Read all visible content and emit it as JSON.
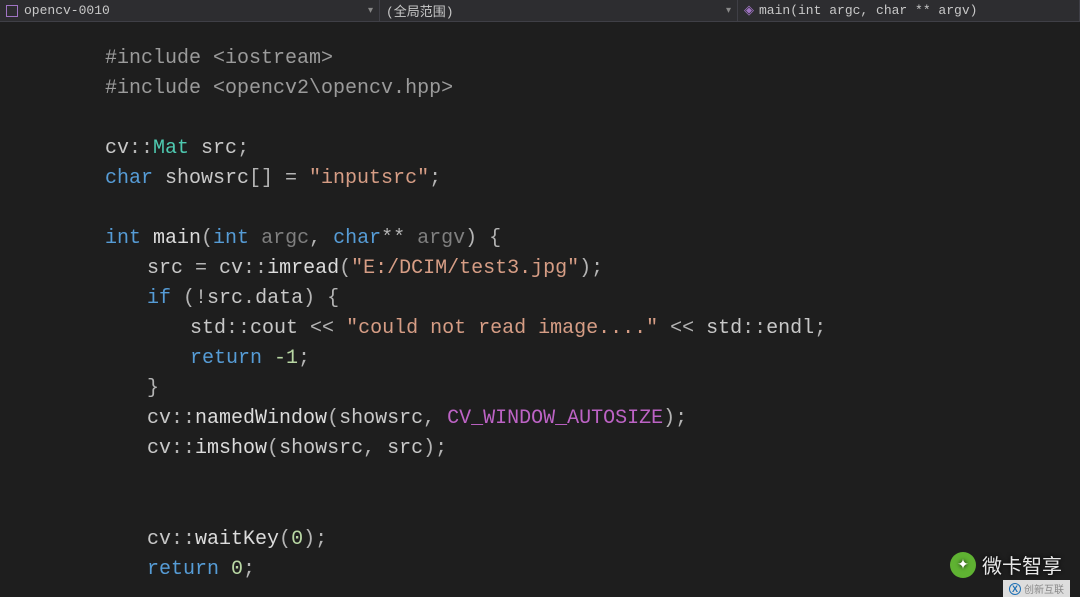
{
  "topbar": {
    "project": "opencv-0010",
    "scope": "(全局范围)",
    "func": "main(int argc, char ** argv)"
  },
  "code": {
    "l1a": "#include ",
    "l1b": "<iostream>",
    "l2a": "#include ",
    "l2b": "<opencv2\\opencv.hpp>",
    "l4a": "cv",
    "l4op": "::",
    "l4b": "Mat",
    "l4c": " src",
    "l4d": ";",
    "l5a": "char",
    "l5b": " showsrc",
    "l5c": "[] = ",
    "l5d": "\"inputsrc\"",
    "l5e": ";",
    "l7a": "int",
    "l7b": " main",
    "l7c": "(",
    "l7d": "int",
    "l7e": " argc",
    "l7f": ", ",
    "l7g": "char",
    "l7h": "**",
    "l7i": " argv",
    "l7j": ") {",
    "l8a": "src ",
    "l8op": "= ",
    "l8b": "cv",
    "l8c": "::",
    "l8d": "imread",
    "l8e": "(",
    "l8f": "\"E:/DCIM/test3.jpg\"",
    "l8g": ")",
    "l8h": ";",
    "l9a": "if",
    "l9b": " (!",
    "l9c": "src",
    "l9d": ".",
    "l9e": "data",
    "l9f": ") {",
    "l10a": "std",
    "l10b": "::",
    "l10c": "cout ",
    "l10d": "<< ",
    "l10e": "\"could not read image....\"",
    "l10f": " << ",
    "l10g": "std",
    "l10h": "::",
    "l10i": "endl",
    "l10j": ";",
    "l11a": "return",
    "l11b": " -1",
    "l11c": ";",
    "l12a": "}",
    "l13a": "cv",
    "l13b": "::",
    "l13c": "namedWindow",
    "l13d": "(",
    "l13e": "showsrc",
    "l13f": ", ",
    "l13g": "CV_WINDOW_AUTOSIZE",
    "l13h": ")",
    "l13i": ";",
    "l14a": "cv",
    "l14b": "::",
    "l14c": "imshow",
    "l14d": "(",
    "l14e": "showsrc",
    "l14f": ", ",
    "l14g": "src",
    "l14h": ")",
    "l14i": ";",
    "l16a": "cv",
    "l16b": "::",
    "l16c": "waitKey",
    "l16d": "(",
    "l16e": "0",
    "l16f": ")",
    "l16g": ";",
    "l17a": "return",
    "l17b": " 0",
    "l17c": ";"
  },
  "wm1": "微卡智享",
  "wm2": "创新互联"
}
